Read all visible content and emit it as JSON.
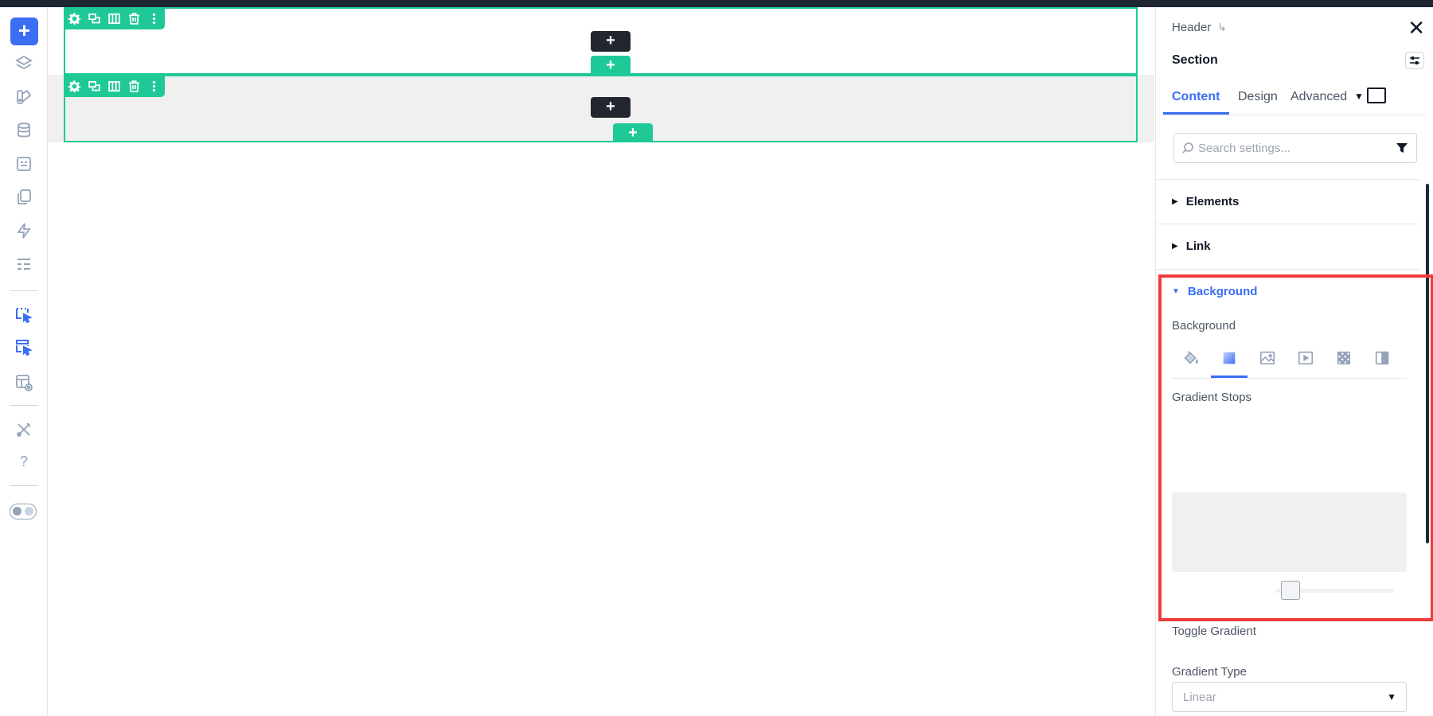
{
  "sidebar": {
    "add_label": "+",
    "icons": [
      "layers-icon",
      "design-icon",
      "database-icon",
      "form-icon",
      "pages-icon",
      "bolt-icon",
      "list-icon",
      "select-element-icon",
      "select-multiple-icon",
      "template-preview-icon",
      "tools-icon",
      "help-icon"
    ],
    "help_label": "?"
  },
  "canvas": {
    "add_label": "+",
    "section_toolbar_icons": [
      "gear-icon",
      "duplicate-icon",
      "columns-icon",
      "trash-icon",
      "more-icon"
    ]
  },
  "panel": {
    "breadcrumb": "Header",
    "breadcrumb_arrow": "↳",
    "close_label": "✕",
    "title": "Section",
    "tabs": [
      {
        "label": "Content",
        "active": true
      },
      {
        "label": "Design",
        "active": false
      },
      {
        "label": "Advanced",
        "active": false
      }
    ],
    "tab_caret": "▼",
    "search": {
      "placeholder": "Search settings..."
    },
    "accordions": {
      "elements": "Elements",
      "link": "Link",
      "background": "Background"
    },
    "tri_closed": "▶",
    "tri_open": "▼",
    "background_label": "Background",
    "background_types": [
      "paint-bucket-icon",
      "gradient-icon",
      "image-icon",
      "video-icon",
      "pattern-icon",
      "overlay-icon"
    ],
    "gradient_stops_label": "Gradient Stops",
    "toggle_gradient_label": "Toggle Gradient",
    "gradient_type_label": "Gradient Type",
    "gradient_type_value": "Linear",
    "select_caret": "▼"
  },
  "colors": {
    "accent": "#3b6ef5",
    "section_green": "#1ec997",
    "highlight_red": "#ef3b3b",
    "dark": "#22272f"
  }
}
